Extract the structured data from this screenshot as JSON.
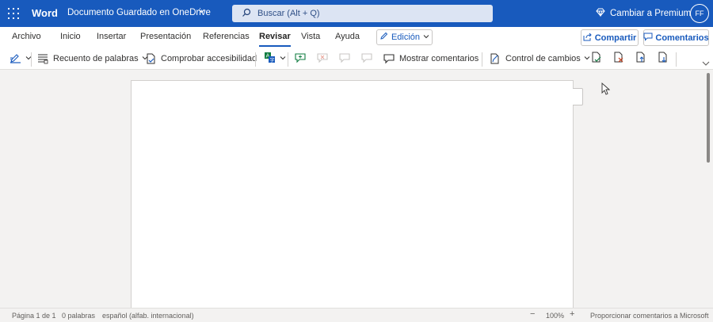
{
  "titlebar": {
    "app_name": "Word",
    "doc_name": "Documento",
    "doc_status": "Guardado en OneDrive",
    "search_placeholder": "Buscar (Alt + Q)",
    "premium_label": "Cambiar a Premium",
    "avatar_initials": "FF"
  },
  "menu": {
    "tabs": [
      {
        "label": "Archivo"
      },
      {
        "label": "Inicio"
      },
      {
        "label": "Insertar"
      },
      {
        "label": "Presentación"
      },
      {
        "label": "Referencias"
      },
      {
        "label": "Revisar"
      },
      {
        "label": "Vista"
      },
      {
        "label": "Ayuda"
      }
    ],
    "active_tab": "Revisar",
    "edit_label": "Edición",
    "share_label": "Compartir",
    "comments_label": "Comentarios"
  },
  "ribbon": {
    "word_count_label": "Recuento de palabras",
    "accessibility_label": "Comprobar accesibilidad",
    "show_comments_label": "Mostrar comentarios",
    "track_changes_label": "Control de cambios"
  },
  "statusbar": {
    "page_info": "Página 1 de 1",
    "word_count": "0 palabras",
    "language": "español (alfab. internacional)",
    "zoom_minus": "−",
    "zoom": "100%",
    "zoom_plus": "+",
    "feedback": "Proporcionar comentarios a Microsoft"
  },
  "colors": {
    "brand": "#185abd",
    "accent_green": "#107c41",
    "delete_red": "#c43e1c"
  }
}
